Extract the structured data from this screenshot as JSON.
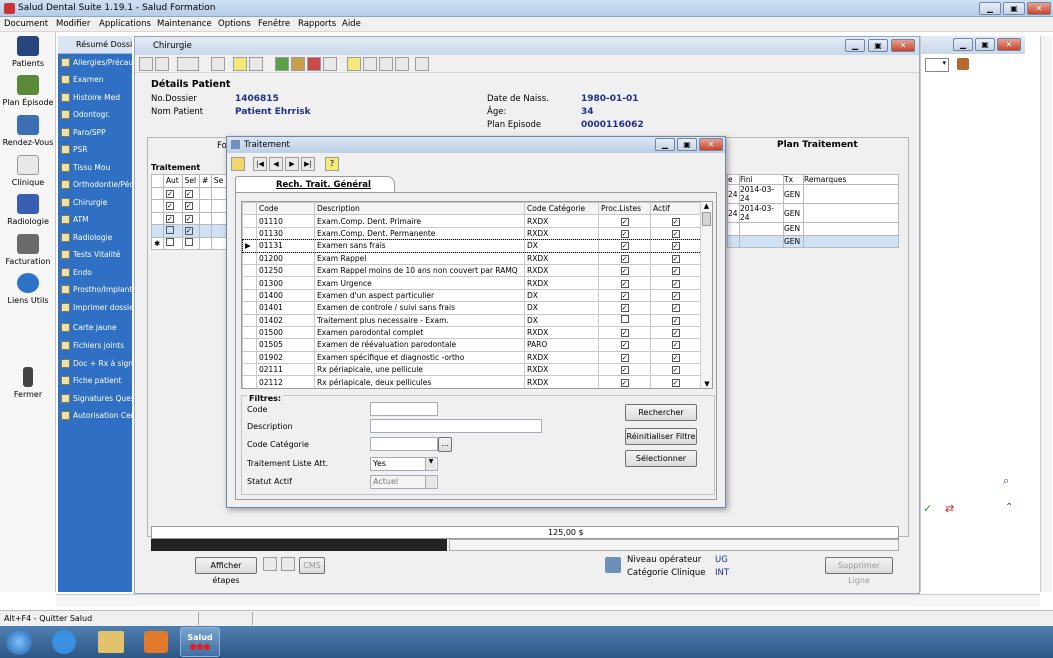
{
  "app": {
    "title": "Salud Dental Suite 1.19.1 - Salud Formation"
  },
  "menu": [
    "Document",
    "Modifier",
    "Applications",
    "Maintenance",
    "Options",
    "Fenêtre",
    "Rapports",
    "Aide"
  ],
  "leftnav": [
    "Patients",
    "Plan Épisode",
    "Rendez-Vous",
    "Clinique",
    "Radiologie",
    "Facturation",
    "Liens Utils",
    "Fermer"
  ],
  "sidepanel": {
    "header": "Résumé Dossier",
    "items": [
      "Allergies/Précautions",
      "Examen",
      "Histoire Med",
      "Odontogr.",
      "Paro/SPP",
      "PSR",
      "Tissu Mou",
      "Orthodontie/Péd",
      "Chirurgie",
      "ATM",
      "Radiologie",
      "Tests Vitalité",
      "Endo",
      "Prostho/Implant",
      "Imprimer dossier",
      "Carte jaune",
      "Fichiers joints",
      "Doc + Rx à signer",
      "Fiche patient",
      "Signatures Quest.",
      "Autorisation Cen"
    ]
  },
  "chirurgie": {
    "title": "Chirurgie",
    "details_title": "Détails Patient",
    "no_dossier_label": "No.Dossier",
    "no_dossier": "1406815",
    "nom_label": "Nom Patient",
    "nom": "Patient Ehrrisk",
    "dob_label": "Date de Naiss.",
    "dob": "1980-01-01",
    "age_label": "Âge:",
    "age": "34",
    "plan_label": "Plan Episode",
    "plan": "0000116062",
    "tab_left": "Fo",
    "tab_right": "Plan Traitement",
    "traitement_label": "Traitement",
    "bt_cols": [
      "Aut",
      "Sel",
      "#",
      "Se"
    ],
    "right_cols": [
      "e",
      "Fini",
      "Tx",
      "Remarques"
    ],
    "right_rows": [
      {
        "e": "24",
        "fini": "2014-03-24",
        "tx": "GEN"
      },
      {
        "e": "24",
        "fini": "2014-03-24",
        "tx": "GEN"
      },
      {
        "e": "",
        "fini": "",
        "tx": "GEN"
      },
      {
        "e": "",
        "fini": "",
        "tx": "GEN"
      }
    ],
    "total": "125,00 $",
    "afficher_btn": "Afficher étapes",
    "cms_btn": "CMS",
    "niveau_label": "Niveau opérateur",
    "niveau": "UG",
    "categorie_label": "Catégorie Clinique",
    "categorie": "INT",
    "supprimer_btn": "Supprimer Ligne"
  },
  "dialog": {
    "title": "Traitement",
    "tab": "Rech. Trait. Général",
    "columns": [
      "Code",
      "Description",
      "Code Catégorie",
      "Proc.Listes",
      "Actif"
    ],
    "rows": [
      {
        "code": "01110",
        "desc": "Exam.Comp. Dent. Primaire",
        "cat": "RXDX",
        "proc": true,
        "actif": true
      },
      {
        "code": "01130",
        "desc": "Exam.Comp. Dent. Permanente",
        "cat": "RXDX",
        "proc": true,
        "actif": true
      },
      {
        "code": "01131",
        "desc": "Examen sans frais",
        "cat": "DX",
        "proc": true,
        "actif": true
      },
      {
        "code": "01200",
        "desc": "Exam Rappel",
        "cat": "RXDX",
        "proc": true,
        "actif": true
      },
      {
        "code": "01250",
        "desc": "Exam Rappel moins de 10 ans non couvert par RAMQ",
        "cat": "RXDX",
        "proc": true,
        "actif": true
      },
      {
        "code": "01300",
        "desc": "Exam Urgence",
        "cat": "RXDX",
        "proc": true,
        "actif": true
      },
      {
        "code": "01400",
        "desc": "Examen d'un aspect particulier",
        "cat": "DX",
        "proc": true,
        "actif": true
      },
      {
        "code": "01401",
        "desc": "Examen de controle / suivi sans frais",
        "cat": "DX",
        "proc": true,
        "actif": true
      },
      {
        "code": "01402",
        "desc": "Traitement plus necessaire - Exam.",
        "cat": "DX",
        "proc": false,
        "actif": true
      },
      {
        "code": "01500",
        "desc": "Examen parodontal complet",
        "cat": "RXDX",
        "proc": true,
        "actif": true
      },
      {
        "code": "01505",
        "desc": "Examen de réévaluation parodontale",
        "cat": "PARO",
        "proc": true,
        "actif": true
      },
      {
        "code": "01902",
        "desc": "Examen spécifique et diagnostic -ortho",
        "cat": "RXDX",
        "proc": true,
        "actif": true
      },
      {
        "code": "02111",
        "desc": "Rx périapicale, une pellicule",
        "cat": "RXDX",
        "proc": true,
        "actif": true
      },
      {
        "code": "02112",
        "desc": "Rx périapicale, deux pellicules",
        "cat": "RXDX",
        "proc": true,
        "actif": true
      }
    ],
    "filtres_title": "Filtres:",
    "code_label": "Code",
    "description_label": "Description",
    "code_cat_label": "Code Catégorie",
    "liste_att_label": "Traitement Liste Att.",
    "liste_att_value": "Yes",
    "statut_label": "Statut Actif",
    "statut_value": "Actuel",
    "rechercher_btn": "Rechercher",
    "reinit_btn": "Réinitialiser Filtre",
    "selectionner_btn": "Sélectionner"
  },
  "statusbar": {
    "hint": "Alt+F4 - Quitter Salud"
  },
  "taskbar": {
    "salud_label": "Salud"
  }
}
